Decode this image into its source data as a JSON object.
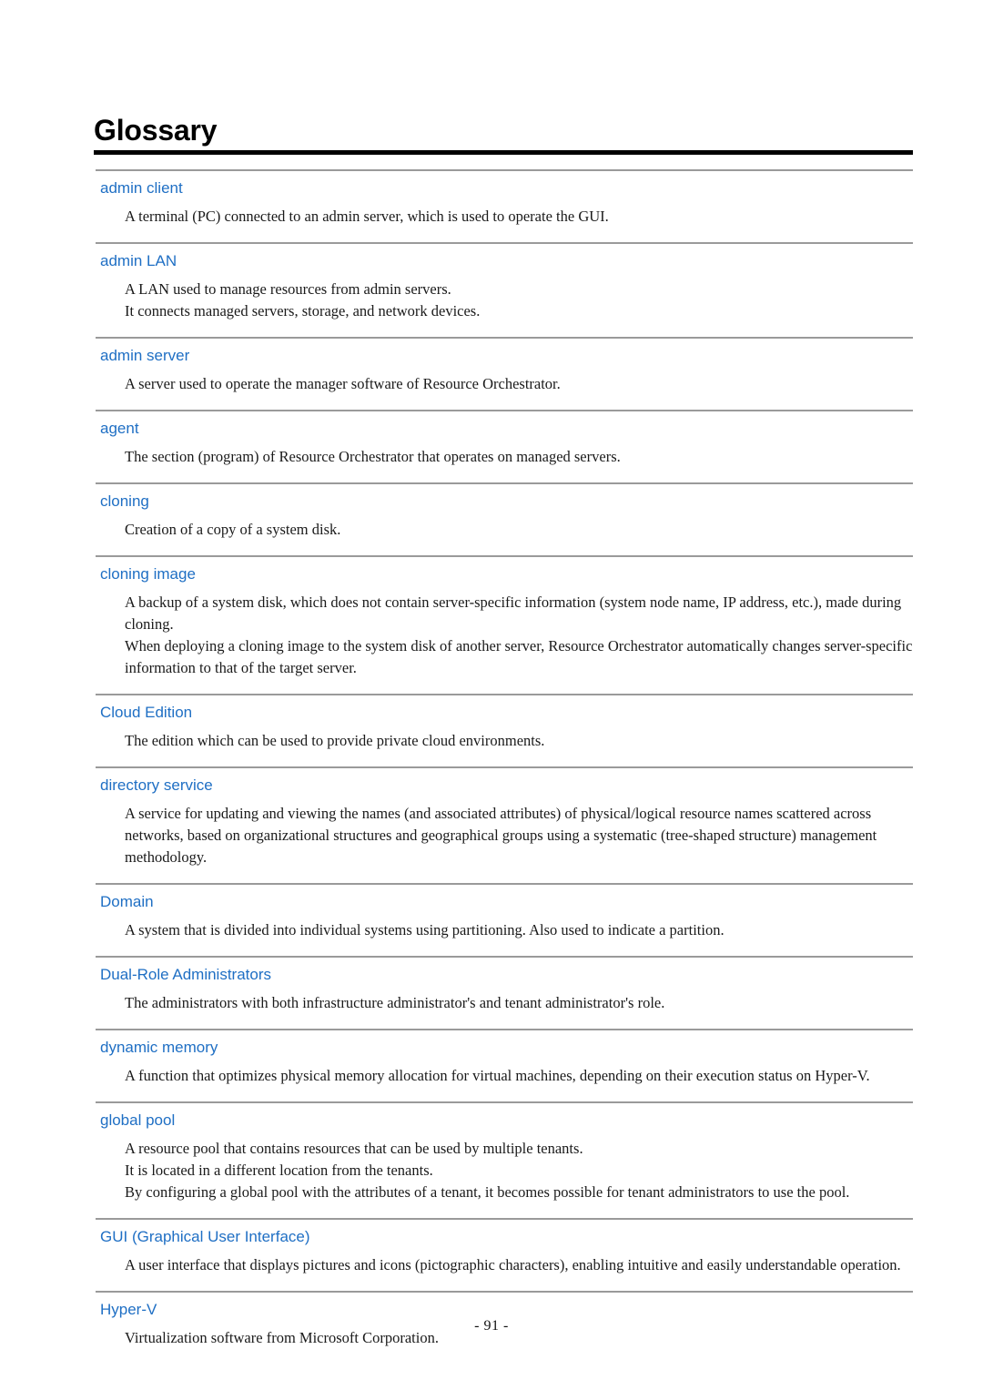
{
  "document": {
    "title": "Glossary",
    "accent_color": "#1f6fc4",
    "rule_color": "#9a9a9a",
    "title_rule_color": "#000000",
    "footer": {
      "page_label": "- 91 -"
    }
  },
  "entries": [
    {
      "term": "admin client",
      "definitions": [
        "A terminal (PC) connected to an admin server, which is used to operate the GUI."
      ]
    },
    {
      "term": "admin LAN",
      "definitions": [
        "A LAN used to manage resources from admin servers.",
        "It connects managed servers, storage, and network devices."
      ]
    },
    {
      "term": "admin server",
      "definitions": [
        "A server used to operate the manager software of Resource Orchestrator."
      ]
    },
    {
      "term": "agent",
      "definitions": [
        "The section (program) of Resource Orchestrator that operates on managed servers."
      ]
    },
    {
      "term": "cloning",
      "definitions": [
        "Creation of a copy of a system disk."
      ]
    },
    {
      "term": "cloning image",
      "definitions": [
        "A backup of a system disk, which does not contain server-specific information (system node name, IP address, etc.), made during cloning.",
        "When deploying a cloning image to the system disk of another server, Resource Orchestrator automatically changes server-specific information to that of the target server."
      ]
    },
    {
      "term": "Cloud Edition",
      "definitions": [
        "The edition which can be used to provide private cloud environments."
      ]
    },
    {
      "term": "directory service",
      "definitions": [
        "A service for updating and viewing the names (and associated attributes) of physical/logical resource names scattered across networks, based on organizational structures and geographical groups using a systematic (tree-shaped structure) management methodology."
      ]
    },
    {
      "term": "Domain",
      "definitions": [
        "A system that is divided into individual systems using partitioning. Also used to indicate a partition."
      ]
    },
    {
      "term": "Dual-Role Administrators",
      "definitions": [
        "The administrators with both infrastructure administrator's and tenant administrator's role."
      ]
    },
    {
      "term": "dynamic memory",
      "definitions": [
        "A function that optimizes physical memory allocation for virtual machines, depending on their execution status on Hyper-V."
      ]
    },
    {
      "term": "global pool",
      "definitions": [
        "A resource pool that contains resources that can be used by multiple tenants.",
        "It is located in a different location from the tenants.",
        "By configuring a global pool with the attributes of a tenant, it becomes possible for tenant administrators to use the pool."
      ]
    },
    {
      "term": "GUI (Graphical User Interface)",
      "definitions": [
        "A user interface that displays pictures and icons (pictographic characters), enabling intuitive and easily understandable operation."
      ]
    },
    {
      "term": "Hyper-V",
      "definitions": [
        "Virtualization software from Microsoft Corporation."
      ]
    }
  ]
}
